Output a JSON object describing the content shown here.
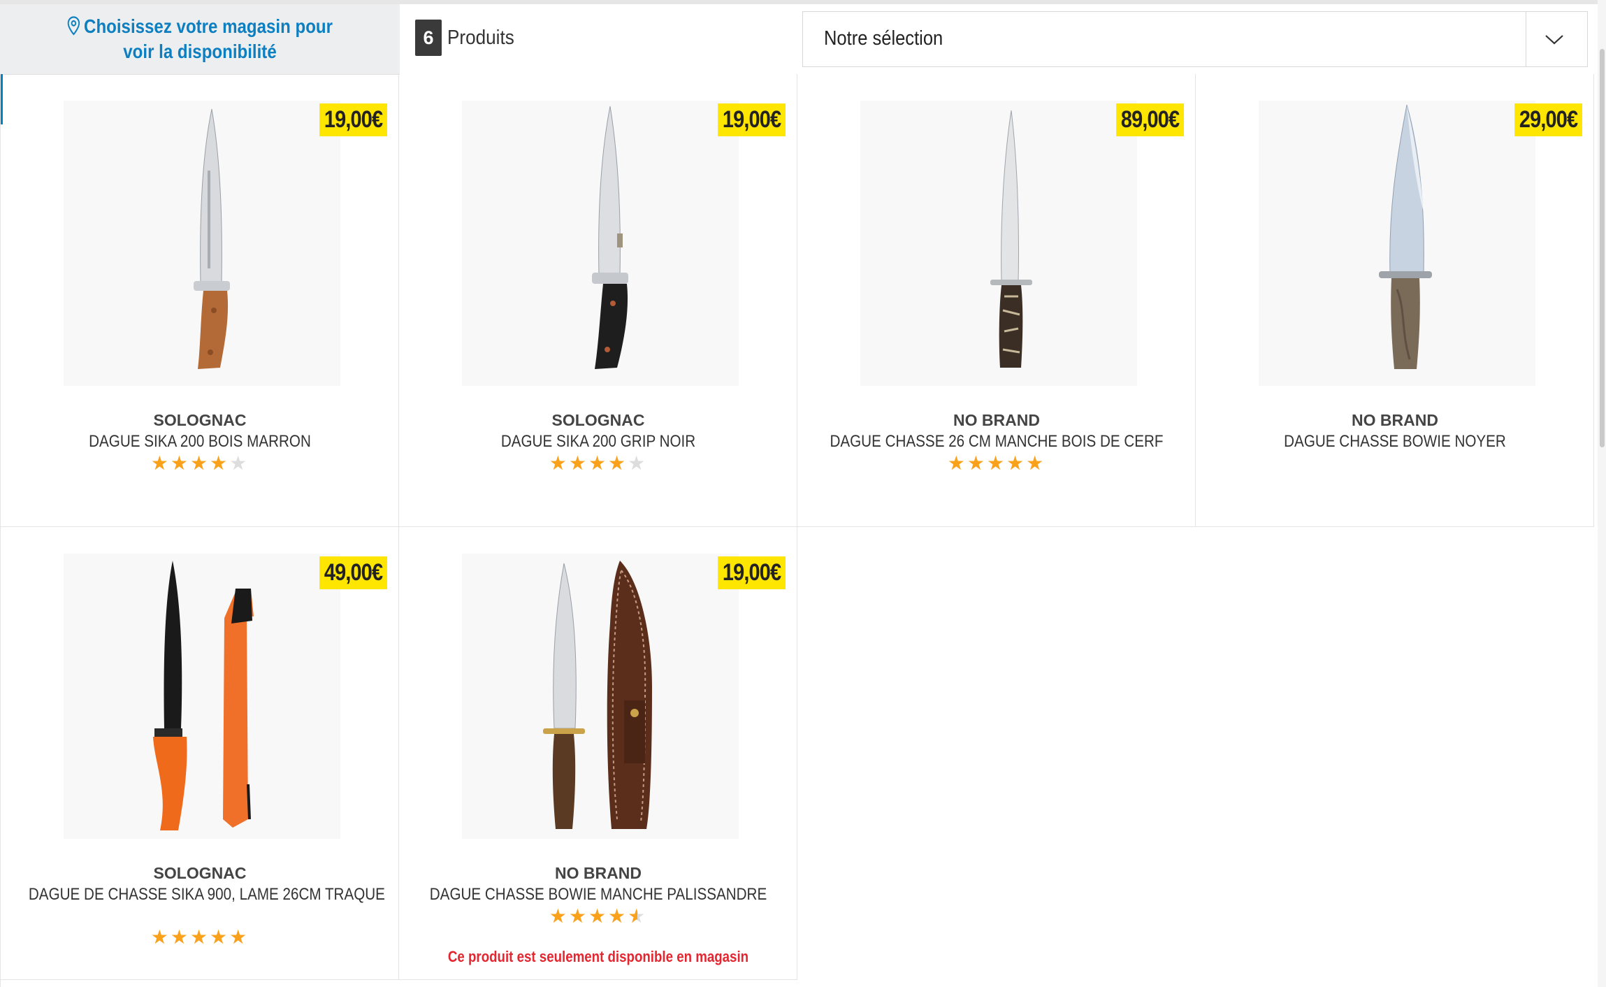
{
  "store_selector": {
    "label": "Choisissez votre magasin pour voir la disponibilité"
  },
  "results": {
    "count": "6",
    "label": "Produits"
  },
  "sort": {
    "selected": "Notre sélection"
  },
  "products": [
    {
      "price": "19,00€",
      "brand": "SOLOGNAC",
      "title": "DAGUE SIKA 200 BOIS MARRON",
      "rating": 4,
      "rating_max": 5,
      "availability": ""
    },
    {
      "price": "19,00€",
      "brand": "SOLOGNAC",
      "title": "DAGUE SIKA 200 GRIP NOIR",
      "rating": 4,
      "rating_max": 5,
      "availability": ""
    },
    {
      "price": "89,00€",
      "brand": "NO BRAND",
      "title": "DAGUE CHASSE 26 CM MANCHE BOIS DE CERF",
      "rating": 5,
      "rating_max": 5,
      "availability": ""
    },
    {
      "price": "29,00€",
      "brand": "NO BRAND",
      "title": "DAGUE CHASSE BOWIE NOYER",
      "rating": 0,
      "rating_max": 5,
      "availability": ""
    },
    {
      "price": "49,00€",
      "brand": "SOLOGNAC",
      "title": "DAGUE DE CHASSE SIKA 900, LAME 26CM TRAQUE",
      "rating": 5,
      "rating_max": 5,
      "availability": ""
    },
    {
      "price": "19,00€",
      "brand": "NO BRAND",
      "title": "DAGUE CHASSE BOWIE MANCHE PALISSANDRE",
      "rating": 4.5,
      "rating_max": 5,
      "availability": "Ce produit est seulement disponible en magasin"
    }
  ],
  "colors": {
    "accent_blue": "#0d7fc0",
    "price_yellow": "#ffe600",
    "star_orange": "#f9a11b",
    "alert_red": "#e3262f"
  },
  "icons": {
    "store": "map-pin-icon",
    "sort": "chevron-down-icon"
  }
}
